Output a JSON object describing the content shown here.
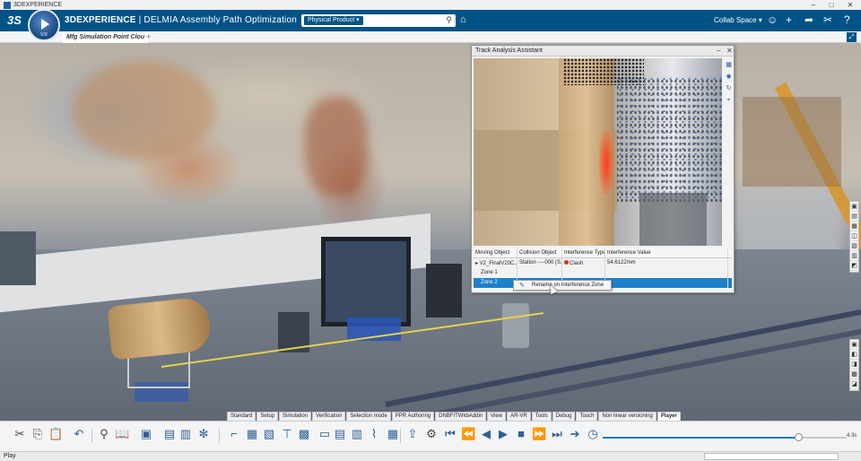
{
  "window": {
    "title": "3DEXPERIENCE",
    "minimize": "–",
    "maximize": "□",
    "close": "✕"
  },
  "header": {
    "logo": "3S",
    "brand_bold": "3DEXPERIENCE",
    "brand_sep": " | ",
    "brand_app": "DELMIA",
    "brand_module": " Assembly Path Optimization",
    "compass_version": "V.R",
    "search_scope": "Physical Product ▾",
    "search_icon": "search-icon",
    "tag_icon": "tag-icon",
    "collab_space": "Collab Space ▾",
    "icons": [
      "user-icon",
      "add-icon",
      "share-icon",
      "tools-icon",
      "help-icon"
    ]
  },
  "tabstrip": {
    "active_tab": "Mfg Simulation Point Clou",
    "add": "+",
    "expand": "⤢"
  },
  "dialog": {
    "title": "Track Analysis Assistant",
    "controls": [
      "–",
      "✕"
    ],
    "columns": [
      "Moving Object",
      "Collision Object",
      "Interference Type",
      "Interference Value"
    ],
    "rows": [
      {
        "moving": "▸ V2_FinalV20C...",
        "collision": "Station ----000 (S...",
        "type": "Clash",
        "value": "54.6122mm"
      },
      {
        "moving": "Zone 1",
        "collision": "",
        "type": "",
        "value": ""
      },
      {
        "moving": "Zone 2",
        "collision": "",
        "type": "",
        "value": ""
      }
    ],
    "selected_row": 2,
    "context_menu": {
      "label": "Rename on Interference Zone"
    }
  },
  "app_tabs": [
    "Standard",
    "Setup",
    "Simulation",
    "Verification",
    "Selection mode",
    "PPR Authoring",
    "DNBFITWkbAddin",
    "View",
    "AR-VR",
    "Tools",
    "Debug",
    "Touch",
    "Non linear versioning",
    "Player"
  ],
  "active_app_tab": "Player",
  "player": {
    "time": "4.3s",
    "progress": 0.8
  },
  "status": {
    "text": "Play"
  },
  "colors": {
    "header": "#005386",
    "selection": "#1e80c8",
    "clash": "#e0301e"
  }
}
